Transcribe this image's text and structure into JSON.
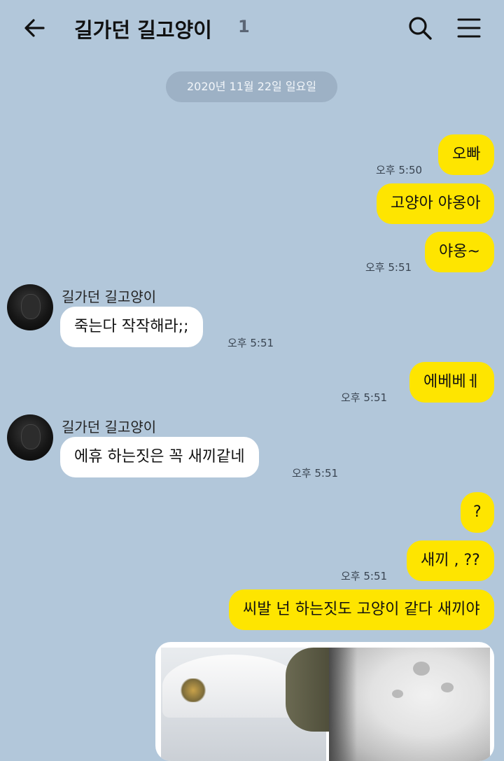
{
  "header": {
    "title": "길가던 길고양이",
    "member_count": "1"
  },
  "date_divider": "2020년 11월 22일 일요일",
  "contact": {
    "name": "길가던 길고양이"
  },
  "messages": [
    {
      "from": "me",
      "text": "오빠",
      "time": "오후 5:50"
    },
    {
      "from": "me",
      "text": "고양아 야옹아",
      "time": ""
    },
    {
      "from": "me",
      "text": "야옹~",
      "time": "오후 5:51"
    },
    {
      "from": "them",
      "text": "죽는다 작작해라;;",
      "time": "오후 5:51"
    },
    {
      "from": "me",
      "text": "에베베ㅔ",
      "time": "오후 5:51"
    },
    {
      "from": "them",
      "text": "에휴 하는짓은 꼭 새끼같네",
      "time": "오후 5:51"
    },
    {
      "from": "me",
      "text": "?",
      "time": ""
    },
    {
      "from": "me",
      "text": "새끼 , ??",
      "time": "오후 5:51"
    },
    {
      "from": "me",
      "text": "씨발 넌 하는짓도 고양이 같다 새끼야",
      "time": ""
    }
  ],
  "colors": {
    "background": "#b2c7da",
    "my_bubble": "#fee500",
    "their_bubble": "#ffffff"
  },
  "icons": {
    "back": "arrow-left-icon",
    "search": "search-icon",
    "menu": "hamburger-menu-icon"
  }
}
